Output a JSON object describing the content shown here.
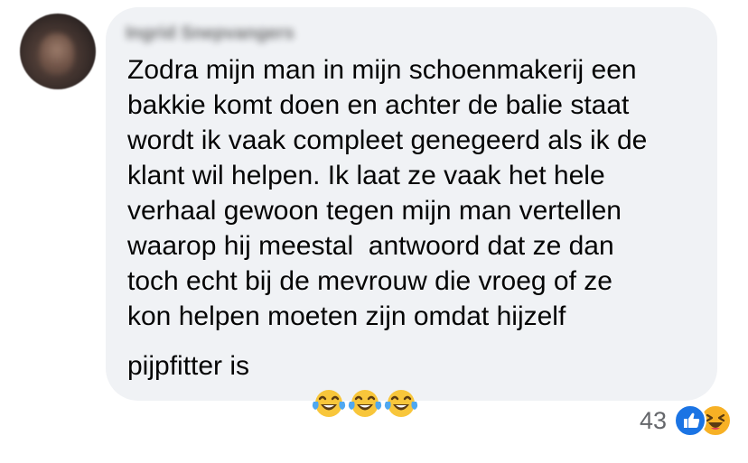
{
  "comment": {
    "author": "Ingrid Snepvangers",
    "lines": [
      "Zodra mijn man in mijn schoenmakerij een",
      "bakkie komt doen en achter de balie staat",
      "wordt ik vaak compleet genegeerd als ik de",
      "klant wil helpen. Ik laat ze vaak het hele",
      "verhaal gewoon tegen mijn man vertellen",
      "waarop hij meestal  antwoord dat ze dan",
      "toch echt bij de mevrouw die vroeg of ze",
      "kon helpen moeten zijn omdat hijzelf"
    ],
    "last_line": "pijpfitter is",
    "trailing_emojis": [
      "face-with-tears-of-joy",
      "face-with-tears-of-joy",
      "face-with-tears-of-joy"
    ]
  },
  "reactions": {
    "count": "43",
    "types": [
      "like-icon",
      "haha-icon"
    ]
  },
  "colors": {
    "bubble": "#f0f2f5",
    "text": "#050505",
    "meta": "#65676b",
    "like": "#1b74e4",
    "haha": "#f7b125"
  }
}
